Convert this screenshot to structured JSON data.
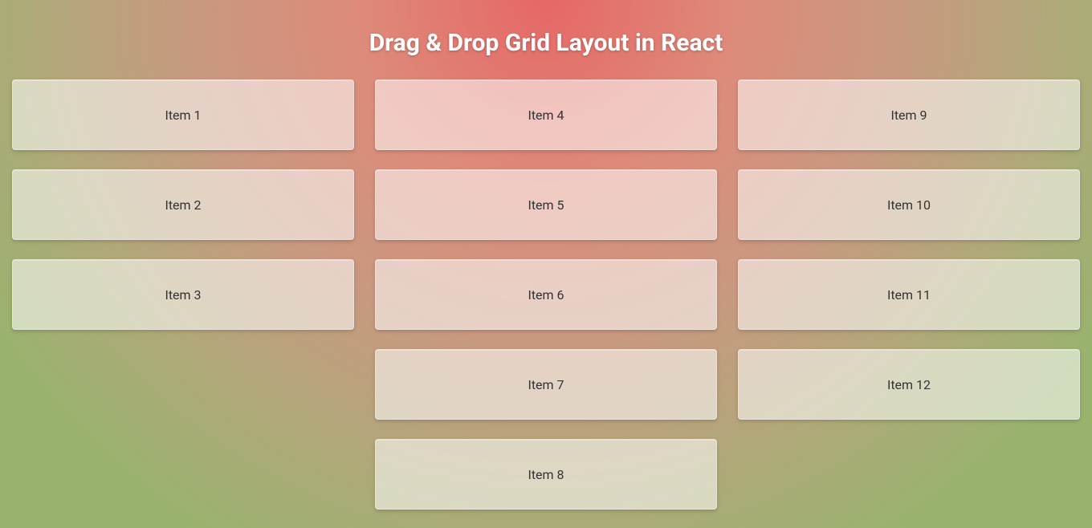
{
  "title": "Drag & Drop Grid Layout in React",
  "columns": [
    {
      "items": [
        {
          "label": "Item 1"
        },
        {
          "label": "Item 2"
        },
        {
          "label": "Item 3"
        }
      ]
    },
    {
      "items": [
        {
          "label": "Item 4"
        },
        {
          "label": "Item 5"
        },
        {
          "label": "Item 6"
        },
        {
          "label": "Item 7"
        },
        {
          "label": "Item 8"
        }
      ]
    },
    {
      "items": [
        {
          "label": "Item 9"
        },
        {
          "label": "Item 10"
        },
        {
          "label": "Item 11"
        },
        {
          "label": "Item 12"
        }
      ]
    }
  ]
}
